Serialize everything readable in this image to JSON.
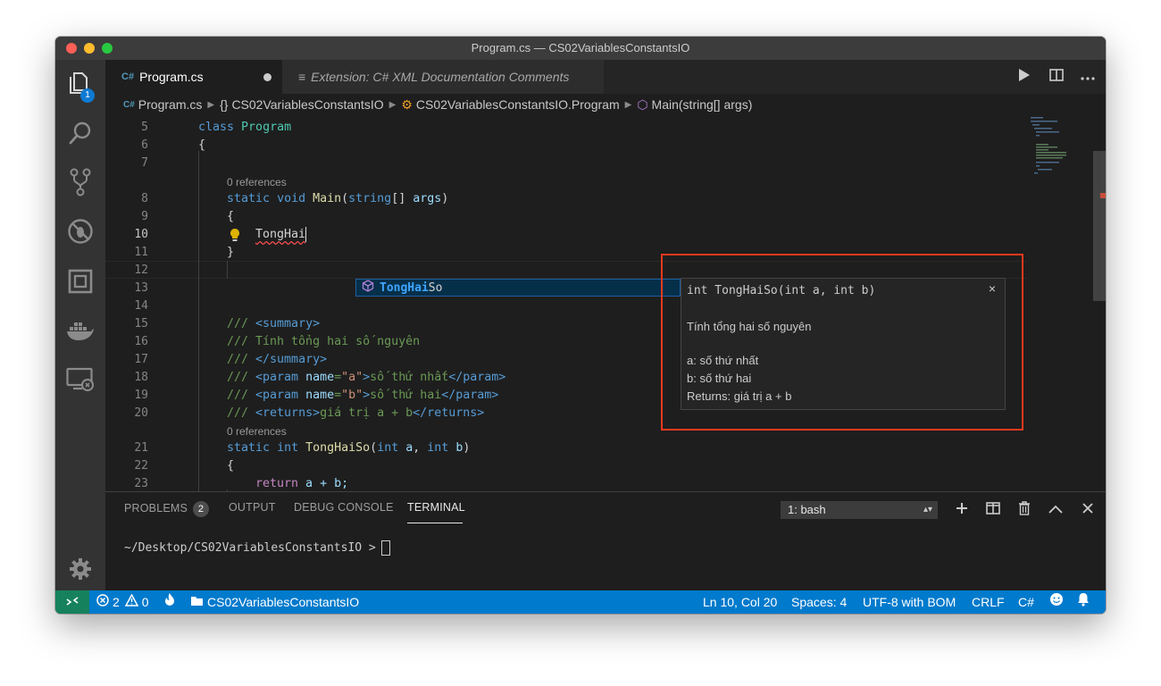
{
  "window": {
    "title": "Program.cs — CS02VariablesConstantsIO"
  },
  "activity": {
    "explorer_badge": "1"
  },
  "tabs": [
    {
      "label": "Program.cs",
      "icon": "C#",
      "active": true
    },
    {
      "label": "Extension: C# XML Documentation Comments",
      "icon": "≡"
    }
  ],
  "breadcrumb": {
    "file": "Program.cs",
    "namespace": "CS02VariablesConstantsIO",
    "class": "CS02VariablesConstantsIO.Program",
    "method": "Main(string[] args)"
  },
  "editor": {
    "line_numbers": [
      "5",
      "6",
      "7",
      "8",
      "9",
      "10",
      "11",
      "12",
      "13",
      "14",
      "15",
      "16",
      "17",
      "18",
      "19",
      "20",
      "21",
      "22",
      "23"
    ],
    "codelens": {
      "main": "0 references",
      "tonghaiso": "0 references"
    },
    "lines": {
      "l5": {
        "kw": "class",
        "name": "Program"
      },
      "l6": "{",
      "l8": {
        "kw1": "static",
        "kw2": "void",
        "fn": "Main",
        "p1": "(",
        "ty": "string",
        "p2": "[] ",
        "arg": "args",
        "p3": ")"
      },
      "l9": "{",
      "l10": "TongHai",
      "l11": "}",
      "l15": {
        "c1": "/// ",
        "tag_open": "<summary>"
      },
      "l16": "/// Tính tổng hai số nguyên",
      "l17": {
        "c1": "/// ",
        "tag_close": "</summary>"
      },
      "l18": {
        "c1": "/// ",
        "t1": "<param ",
        "attr": "name",
        "eq": "=",
        "val": "\"a\"",
        "t2": ">",
        "text": "số thứ nhất",
        "t3": "</param>"
      },
      "l19": {
        "c1": "/// ",
        "t1": "<param ",
        "attr": "name",
        "eq": "=",
        "val": "\"b\"",
        "t2": ">",
        "text": "số thứ hai",
        "t3": "</param>"
      },
      "l20": {
        "c1": "/// ",
        "t1": "<returns>",
        "text": "giá trị a + b",
        "t2": "</returns>"
      },
      "l21": {
        "kw1": "static",
        "kw2": "int",
        "fn": "TongHaiSo",
        "p1": "(",
        "kw3": "int",
        "a": "a",
        "p2": ", ",
        "kw4": "int",
        "b": "b",
        "p3": ")"
      },
      "l22": "{",
      "l23": {
        "kw": "return",
        "expr": " a + b;"
      }
    }
  },
  "suggest": {
    "match": "TongHai",
    "rest": "So",
    "kind_icon": "method-cube-icon"
  },
  "docs": {
    "signature": "int TongHaiSo(int a, int b)",
    "close": "×",
    "summary": "Tính tổng hai số nguyên",
    "param_a": "a: số thứ nhất",
    "param_b": "b: số thứ hai",
    "returns": "Returns: giá trị a + b"
  },
  "panel": {
    "tabs": {
      "problems": "PROBLEMS",
      "output": "OUTPUT",
      "debug": "DEBUG CONSOLE",
      "terminal": "TERMINAL"
    },
    "problems_count": "2",
    "terminal_select": "1: bash",
    "prompt": "~/Desktop/CS02VariablesConstantsIO >"
  },
  "status": {
    "errors": "2",
    "warnings": "0",
    "folder": "CS02VariablesConstantsIO",
    "position": "Ln 10, Col 20",
    "spaces": "Spaces: 4",
    "encoding": "UTF-8 with BOM",
    "eol": "CRLF",
    "language": "C#"
  },
  "colors": {
    "accent": "#007acc",
    "highlight_box": "#e8391e",
    "remote": "#16825d"
  }
}
